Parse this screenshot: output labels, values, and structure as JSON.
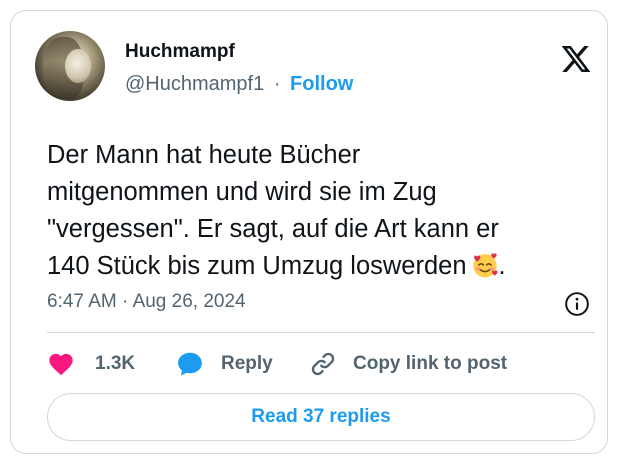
{
  "author": {
    "display_name": "Huchmampf",
    "handle": "@Huchmampf1",
    "separator": "·",
    "follow_label": "Follow"
  },
  "tweet": {
    "lines": [
      "Der Mann hat heute  Bücher",
      "mitgenommen und wird sie im Zug",
      "\"vergessen\". Er sagt, auf die Art kann er",
      "140 Stück bis zum Umzug loswerden"
    ],
    "emoji": "smiling-face-with-hearts",
    "trailing_punct": ".",
    "time": "6:47 AM",
    "separator": "·",
    "date": "Aug 26, 2024"
  },
  "actions": {
    "likes": "1.3K",
    "reply_label": "Reply",
    "copy_link_label": "Copy link to post"
  },
  "read_replies_label": "Read 37 replies",
  "colors": {
    "accent": "#1d9bf0",
    "heart": "#f91880",
    "secondary_text": "#536471",
    "border": "#cfd9de"
  }
}
